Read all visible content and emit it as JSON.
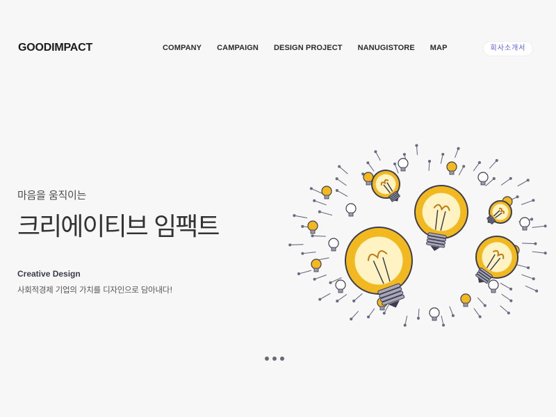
{
  "brand": {
    "logo": "GOODIMPACT"
  },
  "nav": {
    "items": [
      {
        "label": "COMPANY"
      },
      {
        "label": "CAMPAIGN"
      },
      {
        "label": "DESIGN PROJECT"
      },
      {
        "label": "NANUGISTORE"
      },
      {
        "label": "MAP"
      }
    ],
    "intro_button": "회사소개서"
  },
  "hero": {
    "tagline": "마음을 움직이는",
    "headline": "크리에이티브 임팩트",
    "subtitle": "Creative Design",
    "description": "사회적경제 기업의 가치를 디자인으로 담아내다!"
  },
  "colors": {
    "background": "#f7f7f8",
    "accent": "#5a5ce0",
    "bulb_yellow": "#f2b820",
    "bulb_dark": "#3c3c50"
  },
  "icons": {
    "illustration": "light-bulbs-illustration"
  },
  "carousel": {
    "slides": 3
  }
}
